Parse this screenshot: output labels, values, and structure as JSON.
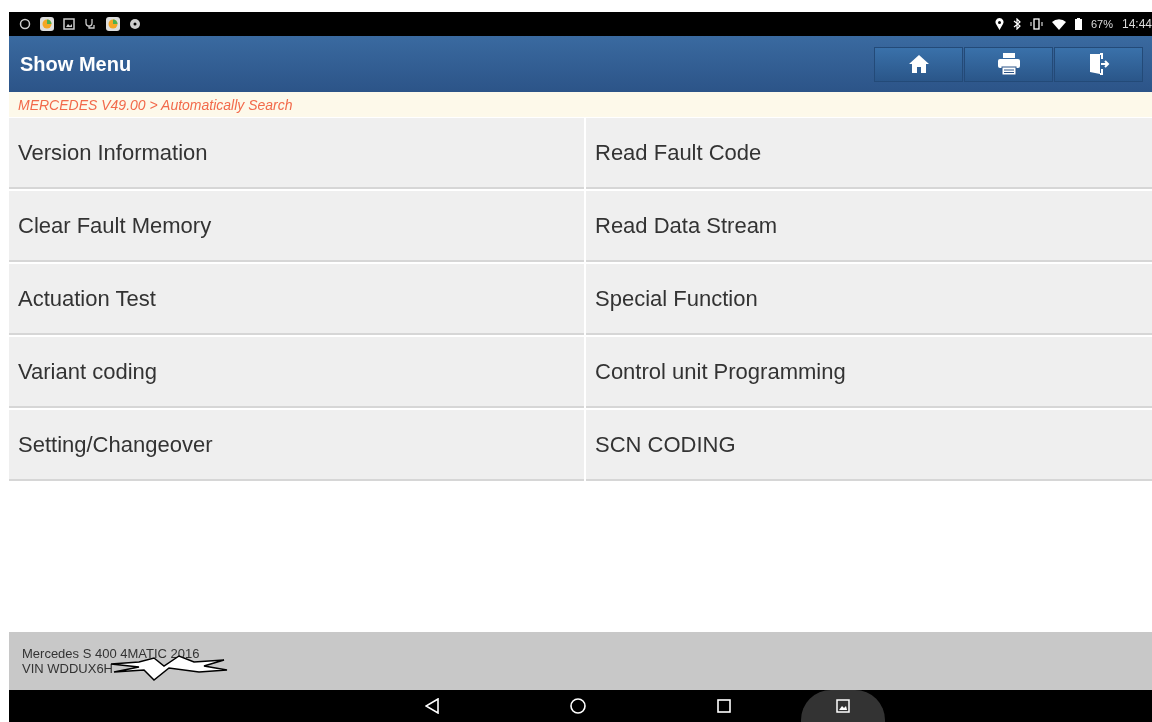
{
  "status_bar": {
    "battery": "67%",
    "time": "14:44"
  },
  "header": {
    "title": "Show Menu"
  },
  "breadcrumb": "MERCEDES V49.00 > Automatically Search",
  "menu_items": [
    {
      "label": "Version Information"
    },
    {
      "label": "Read Fault Code"
    },
    {
      "label": "Clear Fault Memory"
    },
    {
      "label": "Read Data Stream"
    },
    {
      "label": "Actuation Test"
    },
    {
      "label": "Special Function"
    },
    {
      "label": "Variant coding"
    },
    {
      "label": "Control unit Programming"
    },
    {
      "label": "Setting/Changeover"
    },
    {
      "label": "SCN CODING"
    }
  ],
  "footer": {
    "vehicle": "Mercedes S 400 4MATIC 2016",
    "vin": "VIN WDDUX6H"
  }
}
